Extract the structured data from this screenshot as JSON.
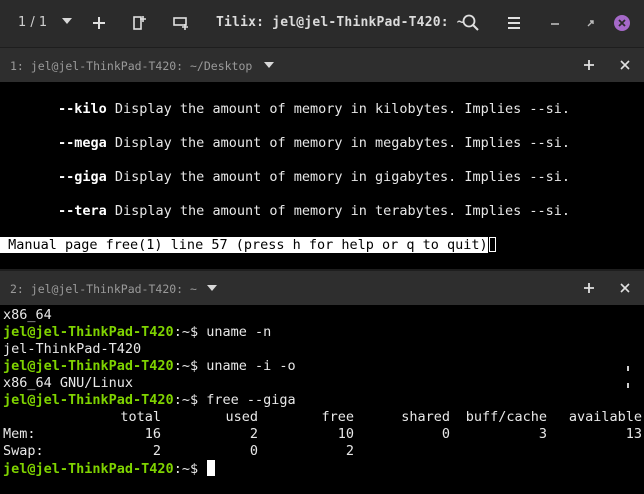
{
  "titlebar": {
    "session_counter": "1 / 1",
    "title": "Tilix: jel@jel-ThinkPad-T420: ~",
    "close_color": "#a569c9"
  },
  "pane1": {
    "title": "1: jel@jel-ThinkPad-T420: ~/Desktop",
    "man_lines": [
      {
        "option": "--kilo",
        "text": " Display the amount of memory in kilobytes. Implies --si."
      },
      {
        "option": "--mega",
        "text": " Display the amount of memory in megabytes. Implies --si."
      },
      {
        "option": "--giga",
        "text": " Display the amount of memory in gigabytes. Implies --si."
      },
      {
        "option": "--tera",
        "text": " Display the amount of memory in terabytes. Implies --si."
      }
    ],
    "status": " Manual page free(1) line 57 (press h for help or q to quit)"
  },
  "pane2": {
    "title": "2: jel@jel-ThinkPad-T420: ~",
    "lines": [
      {
        "prompt": "",
        "text": "x86_64"
      },
      {
        "prompt": "jel@jel-ThinkPad-T420",
        "text": ":~$ uname -n"
      },
      {
        "prompt": "",
        "text": "jel-ThinkPad-T420"
      },
      {
        "prompt": "jel@jel-ThinkPad-T420",
        "text": ":~$ uname -i -o"
      },
      {
        "prompt": "",
        "text": "x86_64 GNU/Linux"
      },
      {
        "prompt": "jel@jel-ThinkPad-T420",
        "text": ":~$ free --giga"
      }
    ],
    "free_table": {
      "headers": [
        "total",
        "used",
        "free",
        "shared",
        "buff/cache",
        "available"
      ],
      "rows": [
        {
          "label": "Mem:",
          "values": [
            "16",
            "2",
            "10",
            "0",
            "3",
            "13"
          ]
        },
        {
          "label": "Swap:",
          "values": [
            "2",
            "0",
            "2",
            "",
            "",
            ""
          ]
        }
      ]
    },
    "final_prompt": "jel@jel-ThinkPad-T420",
    "final_prompt_suffix": ":~$ "
  }
}
